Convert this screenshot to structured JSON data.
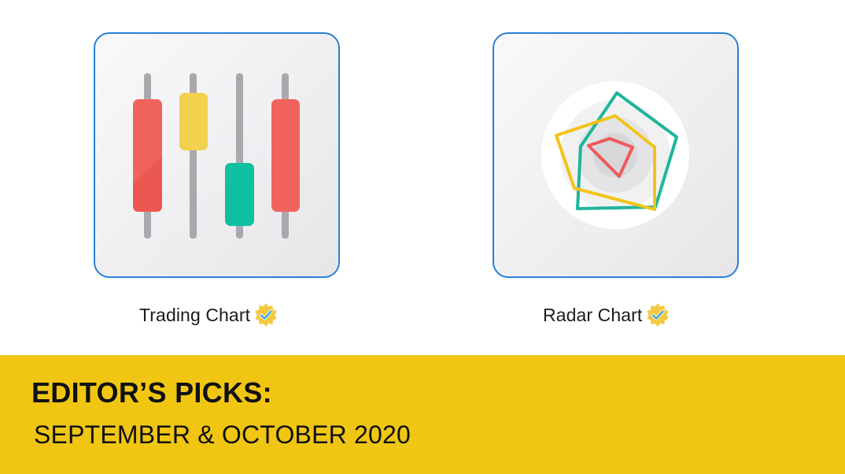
{
  "cards": [
    {
      "label": "Trading Chart",
      "icon": "candlestick-chart-icon",
      "verified_icon": "verified-badge-icon"
    },
    {
      "label": "Radar Chart",
      "icon": "radar-chart-icon",
      "verified_icon": "verified-badge-icon"
    }
  ],
  "banner": {
    "title": "EDITOR’S PICKS:",
    "subtitle": "SEPTEMBER & OCTOBER 2020"
  },
  "colors": {
    "card_border": "#2a7fd4",
    "banner_bg": "#f0c613",
    "candle_red": "#f0635c",
    "candle_yellow": "#f4d04f",
    "candle_teal": "#0fbfa2",
    "radar_teal": "#1fb59b",
    "radar_yellow": "#f2c318",
    "badge_gold": "#f5c842",
    "badge_check": "#2a9fd8"
  }
}
